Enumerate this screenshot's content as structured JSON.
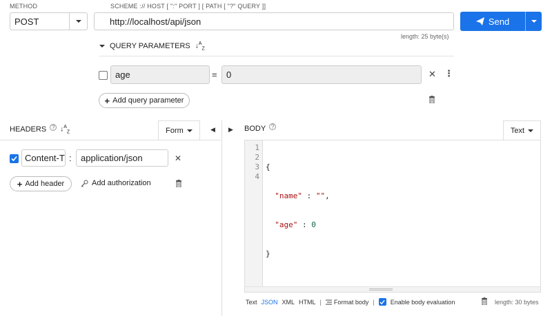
{
  "method": {
    "label": "METHOD",
    "value": "POST"
  },
  "url": {
    "hint": "SCHEME :// HOST [ \":\" PORT ] [ PATH [ \"?\" QUERY ]]",
    "value": "http://localhost/api/json",
    "length_text": "length: 25 byte(s)"
  },
  "send": {
    "label": "Send"
  },
  "query": {
    "title": "QUERY PARAMETERS",
    "params": [
      {
        "name": "age",
        "value": "0",
        "equals": "="
      }
    ],
    "add_label": "Add query parameter"
  },
  "headers": {
    "title": "HEADERS",
    "mode": "Form",
    "items": [
      {
        "name": "Content-T",
        "value": "application/json",
        "sep": ":"
      }
    ],
    "add_label": "Add header",
    "auth_label": "Add authorization"
  },
  "body": {
    "title": "BODY",
    "mode": "Text",
    "line_numbers": [
      "1",
      "2",
      "3",
      "4"
    ],
    "code": {
      "open": "{",
      "key1": "\"name\"",
      "colon1": " : ",
      "val1": "\"\"",
      "comma": ",",
      "key2": "\"age\"",
      "colon2": " : ",
      "val2": "0",
      "close": "}"
    },
    "footer": {
      "text": "Text",
      "json": "JSON",
      "xml": "XML",
      "html": "HTML",
      "sep": "|",
      "format_body": "Format body",
      "enable_eval": "Enable body evaluation",
      "length_text": "length: 30 bytes"
    }
  },
  "colors": {
    "accent": "#1a73e8",
    "json_key": "#a11",
    "json_number": "#164"
  }
}
